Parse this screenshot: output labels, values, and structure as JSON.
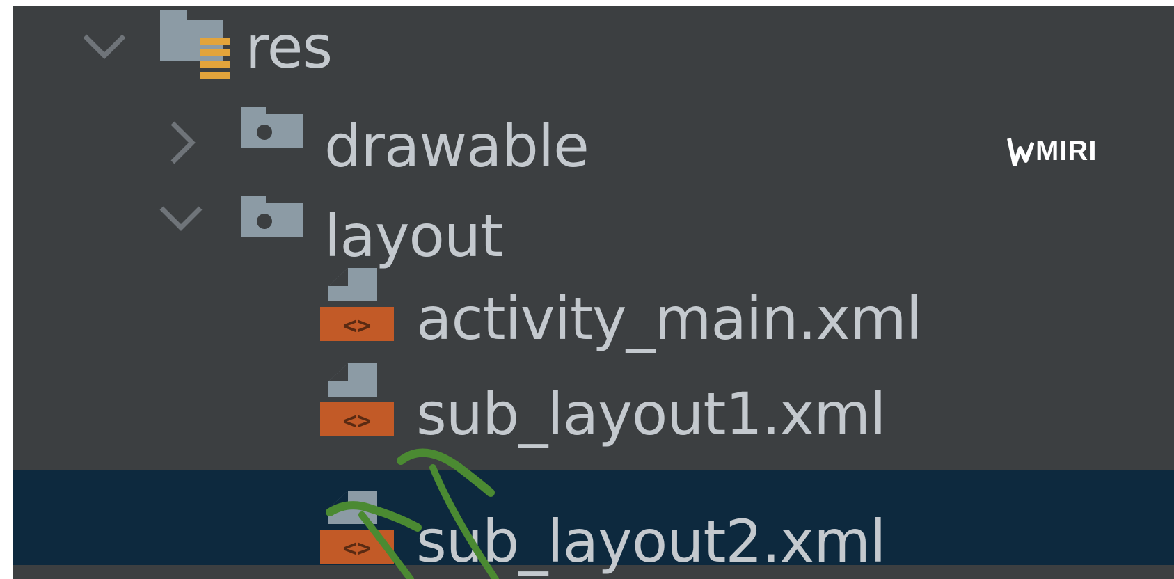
{
  "tree": {
    "items": [
      {
        "label": "res",
        "state": "expanded",
        "icon": "resource-folder-icon"
      },
      {
        "label": "drawable",
        "state": "collapsed",
        "icon": "folder-icon"
      },
      {
        "label": "layout",
        "state": "expanded",
        "icon": "folder-icon"
      },
      {
        "label": "activity_main.xml",
        "icon": "xml-file-icon"
      },
      {
        "label": "sub_layout1.xml",
        "icon": "xml-file-icon"
      },
      {
        "label": "sub_layout2.xml",
        "icon": "xml-file-icon",
        "selected": true
      }
    ]
  },
  "watermark": {
    "text": "MIRI"
  },
  "colors": {
    "background": "#3c3f41",
    "selection": "#0d293e",
    "text": "#c4c9ce",
    "folder_icon": "#8c9ba5",
    "xml_badge": "#c25a27",
    "resource_lines": "#e3a43b",
    "annotation_stroke": "#4b8a32"
  }
}
